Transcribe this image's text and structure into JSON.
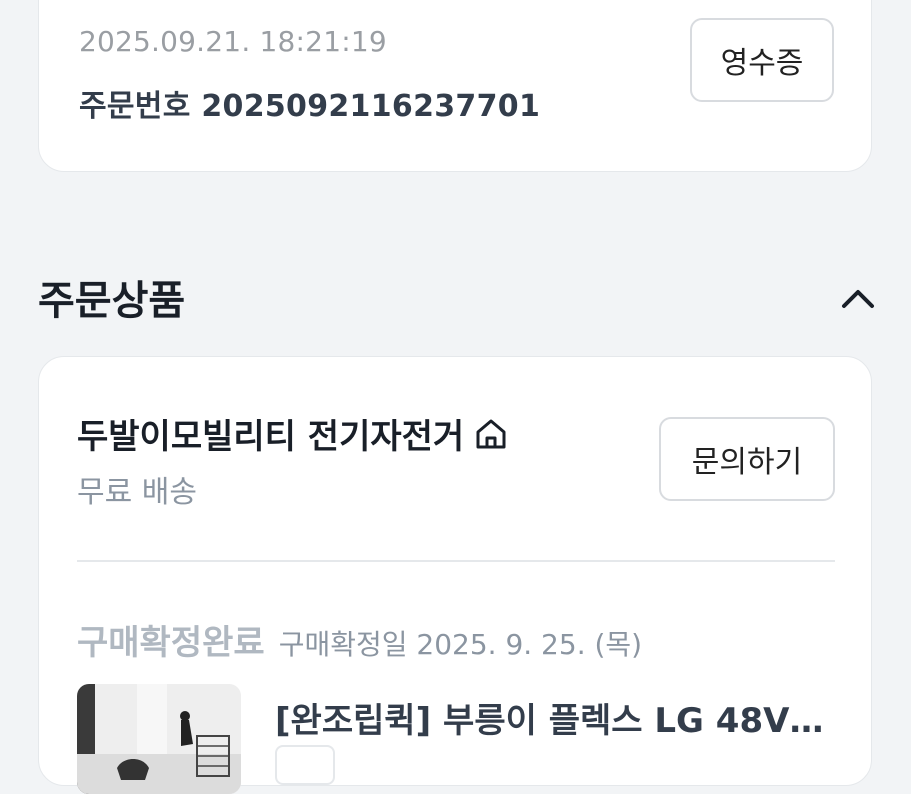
{
  "order": {
    "date": "2025.09.21. 18:21:19",
    "number": "주문번호 2025092116237701",
    "receipt_label": "영수증"
  },
  "section": {
    "title": "주문상품",
    "toggle_icon": "chevron-up-icon"
  },
  "seller": {
    "name": "두발이모빌리티 전기자전거",
    "store_icon": "home-icon",
    "shipping": "무료 배송",
    "inquiry_label": "문의하기"
  },
  "item": {
    "status": "구매확정완료",
    "confirm_date": "구매확정일 2025. 9. 25. (목)",
    "title": "[완조립퀵] 부릉이 플렉스 LG 48V 2..."
  },
  "colors": {
    "background": "#f2f4f6",
    "card": "#ffffff",
    "muted_text": "#8b95a1"
  }
}
